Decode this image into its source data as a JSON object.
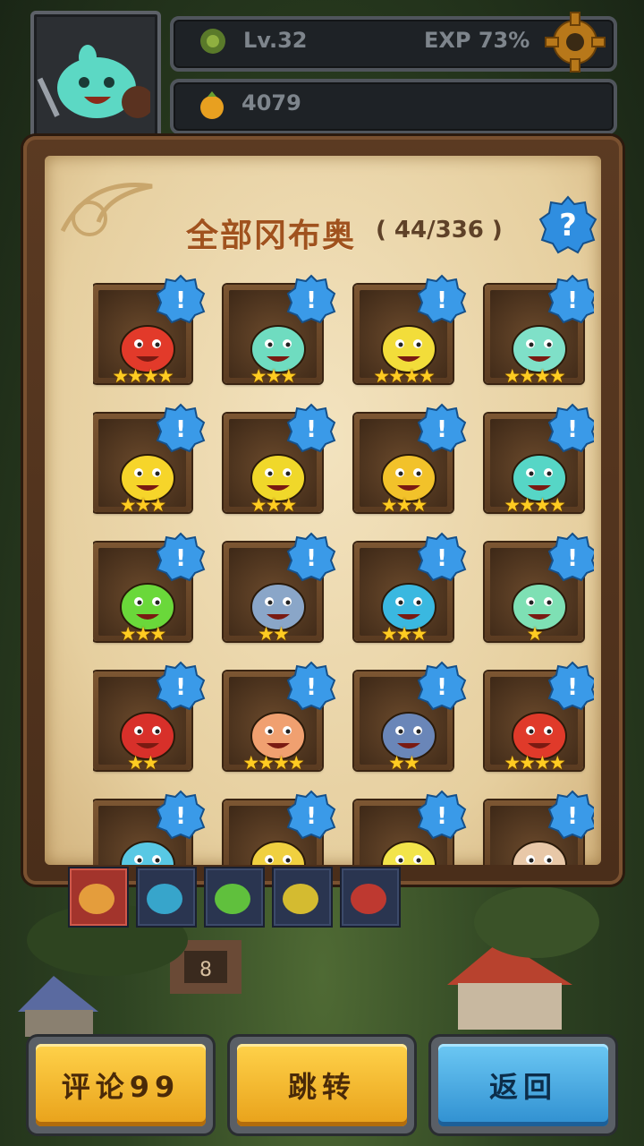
{
  "hud": {
    "level": "Lv.32",
    "exp": "EXP 73%",
    "currency": "4079",
    "settings_icon": "gear-icon"
  },
  "panel": {
    "title": "全部冈布奥",
    "count": "( 44/336 )",
    "help_icon": "question-icon"
  },
  "cards": [
    {
      "stars": "★★★★",
      "color": "#e23a2a"
    },
    {
      "stars": "★★★",
      "color": "#6fdcc0"
    },
    {
      "stars": "★★★★",
      "color": "#f2dd3a"
    },
    {
      "stars": "★★★★",
      "color": "#7fe0c8"
    },
    {
      "stars": "★★★",
      "color": "#f6d52a"
    },
    {
      "stars": "★★★",
      "color": "#f0d82a"
    },
    {
      "stars": "★★★",
      "color": "#f2c22a"
    },
    {
      "stars": "★★★★",
      "color": "#56d6c6"
    },
    {
      "stars": "★★★",
      "color": "#6ad83a"
    },
    {
      "stars": "★★",
      "color": "#8aa6c8"
    },
    {
      "stars": "★★★",
      "color": "#3ab8e0"
    },
    {
      "stars": "★",
      "color": "#7ee0b4"
    },
    {
      "stars": "★★",
      "color": "#d8302a"
    },
    {
      "stars": "★★★★",
      "color": "#f0a070"
    },
    {
      "stars": "★★",
      "color": "#6a86b8"
    },
    {
      "stars": "★★★★",
      "color": "#e03a2a"
    },
    {
      "stars": "",
      "color": "#58c8e4"
    },
    {
      "stars": "",
      "color": "#f0d040"
    },
    {
      "stars": "",
      "color": "#f2e44a"
    },
    {
      "stars": "",
      "color": "#e8c8a8"
    }
  ],
  "tabs": [
    "tab-all",
    "tab-blue",
    "tab-green",
    "tab-yellow",
    "tab-red"
  ],
  "buttons": {
    "comment": "评论99",
    "jump": "跳转",
    "back": "返回"
  }
}
